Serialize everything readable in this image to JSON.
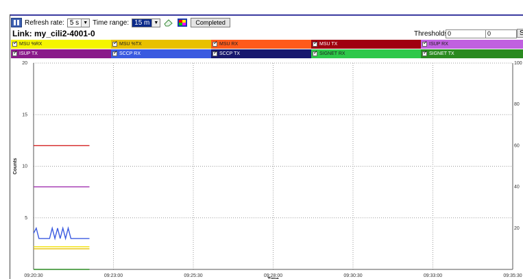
{
  "toolbar": {
    "refresh_label": "Refresh rate:",
    "refresh_value": "5 s",
    "range_label": "Time range:",
    "range_value": "15 m",
    "status": "Completed"
  },
  "link": {
    "title": "Link: my_cili2-4001-0",
    "thresholds_label": "Thresholds:",
    "threshold_1": "0",
    "threshold_2": "0",
    "set_label": "S"
  },
  "legend": [
    {
      "label": "MSU %RX",
      "color": "#f5f500",
      "dark": false
    },
    {
      "label": "MSU %TX",
      "color": "#e8c000",
      "dark": false
    },
    {
      "label": "MSU RX",
      "color": "#ff5a1a",
      "dark": false
    },
    {
      "label": "MSU TX",
      "color": "#a00010",
      "dark": true
    },
    {
      "label": "ISUP RX",
      "color": "#c060e0",
      "dark": false
    },
    {
      "label": "ISUP TX",
      "color": "#8a1a8a",
      "dark": true
    },
    {
      "label": "SCCP RX",
      "color": "#3a5ae0",
      "dark": true
    },
    {
      "label": "SCCP TX",
      "color": "#18186e",
      "dark": true
    },
    {
      "label": "SIGNET RX",
      "color": "#2ec84a",
      "dark": false
    },
    {
      "label": "SIGNET TX",
      "color": "#2a8a20",
      "dark": true
    }
  ],
  "chart_data": {
    "type": "line",
    "xlabel": "Time",
    "ylabel": "Counts",
    "x_ticks": [
      "09:20:30",
      "09:23:00",
      "09:25:30",
      "09:28:00",
      "09:30:30",
      "09:33:00",
      "09:35:30"
    ],
    "y_ticks_left": [
      "5",
      "10",
      "15",
      "20"
    ],
    "y_ticks_right": [
      "20",
      "40",
      "60",
      "80",
      "100"
    ],
    "ylim": [
      0,
      20
    ],
    "ylim_right": [
      0,
      100
    ],
    "grid": true,
    "series": [
      {
        "name": "MSU TX",
        "color": "#d42020",
        "x": [
          "09:20:30",
          "09:22:15"
        ],
        "y": [
          12,
          12
        ]
      },
      {
        "name": "ISUP TX",
        "color": "#a030b0",
        "x": [
          "09:20:30",
          "09:22:15"
        ],
        "y": [
          8,
          8
        ]
      },
      {
        "name": "SCCP RX",
        "color": "#3a5ae0",
        "x": [
          "09:20:30",
          "09:20:35",
          "09:20:40",
          "09:20:45",
          "09:20:50",
          "09:21:00",
          "09:21:05",
          "09:21:10",
          "09:21:15",
          "09:21:20",
          "09:21:25",
          "09:21:30",
          "09:21:35",
          "09:21:40",
          "09:21:45",
          "09:21:50",
          "09:22:15"
        ],
        "y": [
          3.5,
          4,
          3,
          3,
          3,
          3,
          4,
          3,
          4,
          3,
          4,
          3,
          4,
          3,
          3,
          3,
          3
        ]
      },
      {
        "name": "MSU %RX",
        "color": "#f0e000",
        "x": [
          "09:20:30",
          "09:22:15"
        ],
        "y": [
          2.2,
          2.2
        ]
      },
      {
        "name": "MSU %TX",
        "color": "#e8c000",
        "x": [
          "09:20:30",
          "09:22:15"
        ],
        "y": [
          2.0,
          2.0
        ]
      },
      {
        "name": "SIGNET TX",
        "color": "#2a8a20",
        "x": [
          "09:20:30",
          "09:22:15"
        ],
        "y": [
          0,
          0
        ]
      }
    ]
  }
}
